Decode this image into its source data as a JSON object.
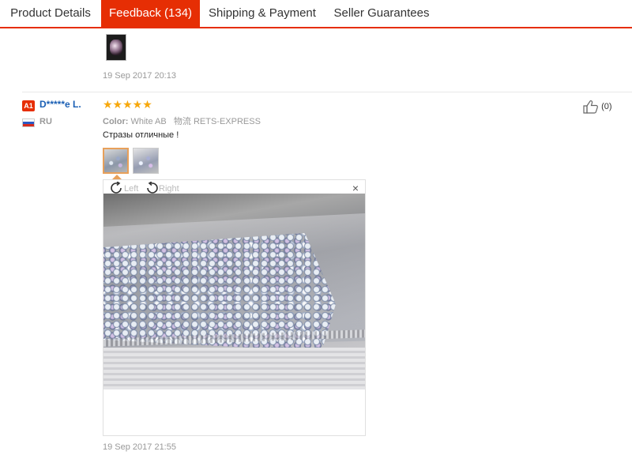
{
  "tabs": [
    {
      "label": "Product Details",
      "active": false
    },
    {
      "label": "Feedback (134)",
      "active": true
    },
    {
      "label": "Shipping & Payment",
      "active": false
    },
    {
      "label": "Seller Guarantees",
      "active": false
    }
  ],
  "previous_review": {
    "date": "19 Sep 2017 20:13"
  },
  "review": {
    "badge": "A1",
    "username": "D*****e L.",
    "country": "RU",
    "stars": "★★★★★",
    "rating": 5,
    "color_label": "Color:",
    "color_value": "White AB",
    "shipping_label": "物流",
    "shipping_value": "RETS-EXPRESS",
    "text": "Стразы отличные !",
    "likes": "(0)",
    "date": "19 Sep 2017 21:55",
    "viewer": {
      "left_label": "Left",
      "right_label": "Right",
      "close": "×"
    }
  },
  "colors": {
    "accent": "#e62e04",
    "star": "#f7a80c",
    "link": "#1a5fb4"
  }
}
